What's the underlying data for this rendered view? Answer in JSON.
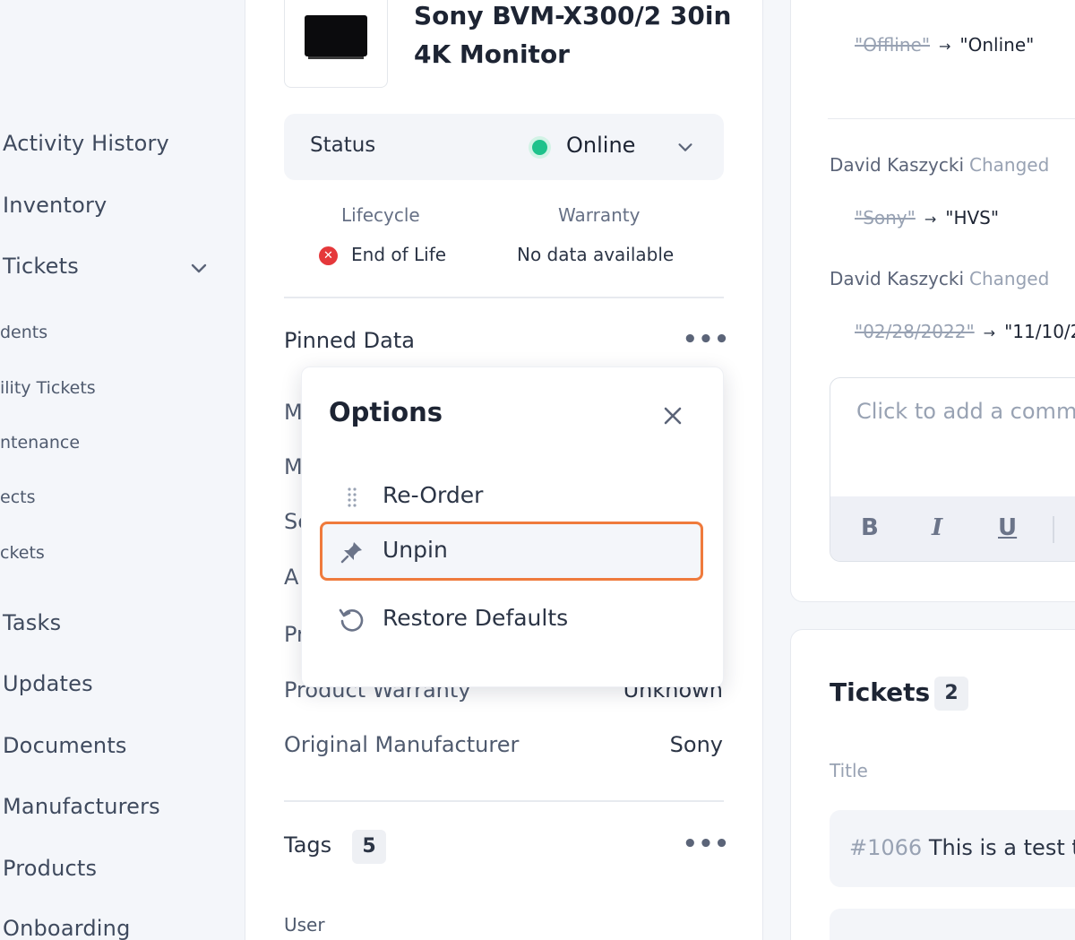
{
  "sidebar": {
    "items": [
      {
        "label": "Activity History"
      },
      {
        "label": "Inventory"
      },
      {
        "label": "Tickets"
      },
      {
        "label": "dents"
      },
      {
        "label": "ility Tickets"
      },
      {
        "label": "ntenance"
      },
      {
        "label": "ects"
      },
      {
        "label": "ckets"
      },
      {
        "label": "Tasks"
      },
      {
        "label": "Updates"
      },
      {
        "label": "Documents"
      },
      {
        "label": "Manufacturers"
      },
      {
        "label": "Products"
      },
      {
        "label": "Onboarding"
      }
    ]
  },
  "product": {
    "title": "Sony BVM-X300/2 30in 4K Monitor",
    "status_label": "Status",
    "status_value": "Online",
    "status_color": "#1ec28b",
    "lifecycle_label": "Lifecycle",
    "lifecycle_value": "End of Life",
    "warranty_label": "Warranty",
    "warranty_value": "No data available"
  },
  "pinned": {
    "title": "Pinned Data",
    "more": "•••",
    "rows": [
      {
        "label": "M"
      },
      {
        "label": "M"
      },
      {
        "label": "Se"
      },
      {
        "label": "A"
      },
      {
        "label": "Pr"
      },
      {
        "label": "Product Warranty",
        "value": "Unknown"
      },
      {
        "label": "Original Manufacturer",
        "value": "Sony"
      }
    ]
  },
  "options": {
    "title": "Options",
    "items": [
      {
        "label": "Re-Order",
        "icon": "drag-handle-icon"
      },
      {
        "label": "Unpin",
        "icon": "pin-icon"
      },
      {
        "label": "Restore Defaults",
        "icon": "restore-icon"
      }
    ],
    "highlight_color": "#ef7a3c"
  },
  "tags": {
    "title": "Tags",
    "count": "5",
    "more": "•••",
    "first_label": "User"
  },
  "history": {
    "entries": [
      {
        "author": "",
        "action": "",
        "old": "\"Offline\"",
        "new": "\"Online\""
      },
      {
        "author": "David Kaszycki",
        "action": "Changed",
        "old": "\"Sony\"",
        "new": "\"HVS\""
      },
      {
        "author": "David Kaszycki",
        "action": "Changed",
        "old": "\"02/28/2022\"",
        "new": "\"11/10/2"
      }
    ],
    "arrow": "→"
  },
  "comment": {
    "placeholder": "Click to add a comm",
    "bold": "B",
    "italic": "I",
    "underline": "U"
  },
  "tickets": {
    "title": "Tickets",
    "count": "2",
    "column_title": "Title",
    "rows": [
      {
        "number": "#1066",
        "text": "This is a test t"
      }
    ]
  }
}
